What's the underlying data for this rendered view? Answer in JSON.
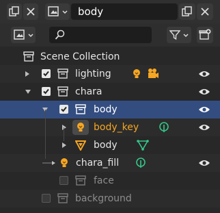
{
  "header": {
    "view_layer_name": "body",
    "icons": [
      "editor-type-icon",
      "copy-icon",
      "close-icon"
    ]
  },
  "filter_bar": {
    "search_placeholder": "",
    "icons": [
      "display-mode-icon",
      "search-icon",
      "filter-icon",
      "new-collection-icon"
    ]
  },
  "tree": {
    "scene": "Scene Collection",
    "rows": [
      {
        "label": "lighting",
        "kind": "collection",
        "checked": true,
        "expanded": false,
        "color": "#e6e6e6"
      },
      {
        "label": "chara",
        "kind": "collection",
        "checked": true,
        "expanded": true,
        "color": "#e6e6e6"
      },
      {
        "label": "body",
        "kind": "collection",
        "checked": true,
        "expanded": true,
        "selected": true,
        "color": "#ffffff"
      },
      {
        "label": "body_key",
        "kind": "light",
        "expanded": false,
        "active": true,
        "color": "#f5a623"
      },
      {
        "label": "body",
        "kind": "mesh",
        "expanded": false,
        "color": "#e6e6e6"
      },
      {
        "label": "chara_fill",
        "kind": "light",
        "color": "#e6e6e6"
      },
      {
        "label": "face",
        "kind": "collection",
        "checked": false,
        "color": "#8c8c8c"
      },
      {
        "label": "background",
        "kind": "collection",
        "checked": false,
        "color": "#8c8c8c"
      }
    ]
  },
  "colors": {
    "selected_row": "#334d80",
    "active_object_text": "#f5a623",
    "light_icon": "#f5a623",
    "constraint_green": "#34c78a"
  }
}
